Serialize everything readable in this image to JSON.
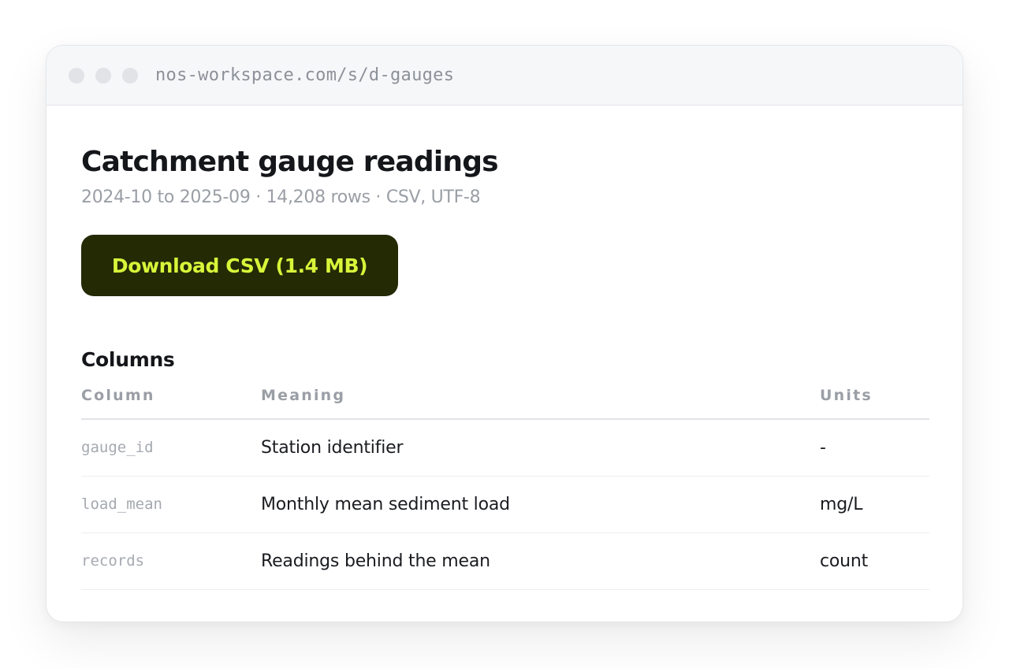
{
  "browser": {
    "url": "nos-workspace.com/s/d-gauges"
  },
  "dataset": {
    "title": "Catchment gauge readings",
    "meta": "2024-10 to 2025-09 · 14,208 rows · CSV, UTF-8",
    "download_label": "Download CSV (1.4 MB)"
  },
  "columns_section": {
    "title": "Columns",
    "headers": [
      "Column",
      "Meaning",
      "Units"
    ],
    "rows": [
      {
        "column": "gauge_id",
        "meaning": "Station identifier",
        "units": "-"
      },
      {
        "column": "load_mean",
        "meaning": "Monthly mean sediment load",
        "units": "mg/L"
      },
      {
        "column": "records",
        "meaning": "Readings behind the mean",
        "units": "count"
      }
    ]
  },
  "colors": {
    "button_bg": "#232a04",
    "button_text": "#d8f53a"
  }
}
